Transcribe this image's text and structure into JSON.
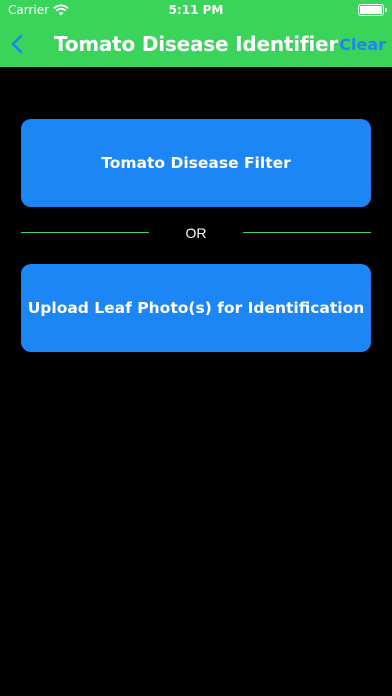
{
  "status_bar": {
    "carrier": "Carrier",
    "time": "5:11 PM"
  },
  "nav": {
    "title": "Tomato Disease Identifier",
    "clear_label": "Clear"
  },
  "actions": {
    "filter_label": "Tomato Disease Filter",
    "separator_label": "OR",
    "upload_label": "Upload Leaf Photo(s) for Identification"
  },
  "colors": {
    "header_green": "#3ad45a",
    "button_blue": "#1c86f7",
    "link_blue": "#1e84f5",
    "background": "#000000"
  }
}
